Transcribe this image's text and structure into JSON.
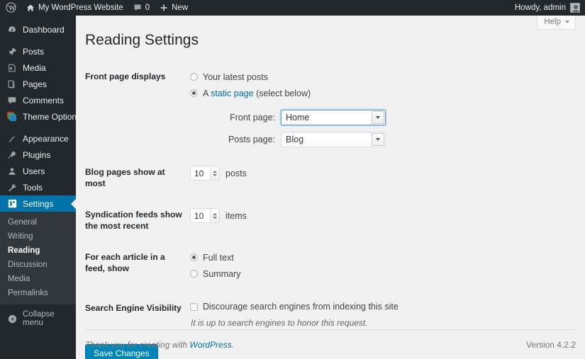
{
  "adminbar": {
    "logo_icon": "wordpress-logo-icon",
    "home_icon": "home-icon",
    "site_name": "My WordPress Website",
    "comments_icon": "comment-bubble-icon",
    "comments_count": "0",
    "new_icon": "plus-icon",
    "new_label": "New",
    "howdy": "Howdy, admin",
    "avatar": "avatar"
  },
  "sidebar": {
    "items": [
      {
        "label": "Dashboard",
        "icon": "dashboard-icon",
        "current": false
      },
      {
        "label": "Posts",
        "icon": "pin-icon",
        "current": false
      },
      {
        "label": "Media",
        "icon": "media-icon",
        "current": false
      },
      {
        "label": "Pages",
        "icon": "pages-icon",
        "current": false
      },
      {
        "label": "Comments",
        "icon": "comment-bubble-icon",
        "current": false
      },
      {
        "label": "Theme Options",
        "icon": "theme-options-icon",
        "current": false
      },
      {
        "label": "Appearance",
        "icon": "brush-icon",
        "current": false
      },
      {
        "label": "Plugins",
        "icon": "plugin-icon",
        "current": false
      },
      {
        "label": "Users",
        "icon": "user-icon",
        "current": false
      },
      {
        "label": "Tools",
        "icon": "wrench-icon",
        "current": false
      },
      {
        "label": "Settings",
        "icon": "settings-icon",
        "current": true
      }
    ],
    "submenu": [
      {
        "label": "General",
        "current": false
      },
      {
        "label": "Writing",
        "current": false
      },
      {
        "label": "Reading",
        "current": true
      },
      {
        "label": "Discussion",
        "current": false
      },
      {
        "label": "Media",
        "current": false
      },
      {
        "label": "Permalinks",
        "current": false
      }
    ],
    "collapse": {
      "label": "Collapse menu",
      "icon": "collapse-arrow-icon"
    }
  },
  "help_tab": {
    "label": "Help",
    "icon": "chevron-down-icon"
  },
  "page": {
    "title": "Reading Settings",
    "front_page_displays": {
      "label": "Front page displays",
      "option_latest": {
        "text": "Your latest posts",
        "selected": false
      },
      "option_static_prefix": "A ",
      "option_static_link": "static page",
      "option_static_suffix": " (select below)",
      "selected_static": true,
      "front_page_label": "Front page:",
      "front_page_value": "Home",
      "posts_page_label": "Posts page:",
      "posts_page_value": "Blog"
    },
    "blog_pages": {
      "label": "Blog pages show at most",
      "value": "10",
      "unit": "posts"
    },
    "syndication": {
      "label": "Syndication feeds show the most recent",
      "value": "10",
      "unit": "items"
    },
    "feed_article": {
      "label": "For each article in a feed, show",
      "option_full": {
        "text": "Full text",
        "selected": true
      },
      "option_summary": {
        "text": "Summary",
        "selected": false
      }
    },
    "search_visibility": {
      "label": "Search Engine Visibility",
      "checkbox_label": "Discourage search engines from indexing this site",
      "checked": false,
      "hint": "It is up to search engines to honor this request."
    },
    "save_button": "Save Changes"
  },
  "footer": {
    "thanks_prefix": "Thank you for creating with ",
    "thanks_link": "WordPress",
    "thanks_suffix": ".",
    "version": "Version 4.2.2"
  },
  "colors": {
    "admin_dark": "#23282d",
    "submenu_dark": "#32373c",
    "accent_blue": "#0073aa",
    "button_blue": "#0085ba",
    "content_bg": "#f1f1f1"
  }
}
